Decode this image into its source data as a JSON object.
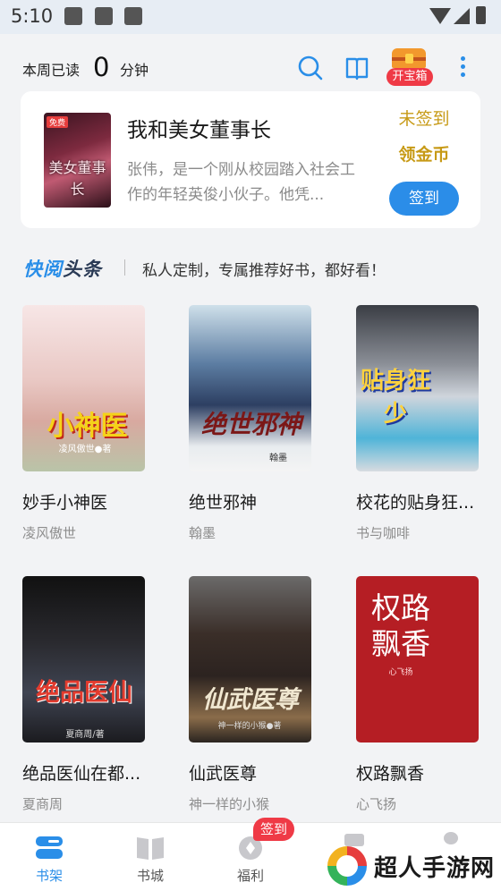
{
  "status_bar": {
    "time": "5:10"
  },
  "header": {
    "read_label": "本周已读",
    "read_minutes": "0",
    "read_unit": "分钟",
    "chest_label": "开宝箱"
  },
  "featured": {
    "cover_tag": "免费",
    "cover_text": "美女董事长",
    "title": "我和美女董事长",
    "description": "张伟，是一个刚从校园踏入社会工作的年轻英俊小伙子。他凭...",
    "sign_status": "未签到",
    "coin_label": "领金币",
    "sign_button": "签到"
  },
  "headline": {
    "logo_a": "快阅",
    "logo_b": "头条",
    "text": "私人定制，专属推荐好书，都好看！"
  },
  "books": [
    {
      "title": "妙手小神医",
      "author": "凌风傲世",
      "cover_text": "小神医",
      "cover_sub": "凌风傲世●著"
    },
    {
      "title": "绝世邪神",
      "author": "翰墨",
      "cover_text": "绝世邪神",
      "cover_sub": "翰墨"
    },
    {
      "title": "校花的贴身狂...",
      "author": "书与咖啡",
      "cover_text": "贴身狂少",
      "cover_sub": ""
    },
    {
      "title": "绝品医仙在都...",
      "author": "夏商周",
      "cover_text": "绝品医仙",
      "cover_sub": "夏商周/著"
    },
    {
      "title": "仙武医尊",
      "author": "神一样的小猴",
      "cover_text": "仙武医尊",
      "cover_sub": "神一样的小猴●著"
    },
    {
      "title": "权路飘香",
      "author": "心飞扬",
      "cover_text": "权路飘香",
      "cover_sub": "心飞扬"
    }
  ],
  "bottom_nav": {
    "items": [
      {
        "label": "书架",
        "active": true
      },
      {
        "label": "书城",
        "active": false
      },
      {
        "label": "福利",
        "active": false
      }
    ],
    "badge": "签到"
  },
  "watermark": {
    "text": "超人手游网"
  },
  "colors": {
    "accent": "#2a8ee8",
    "gold": "#c79a16",
    "red": "#ef3a46"
  }
}
